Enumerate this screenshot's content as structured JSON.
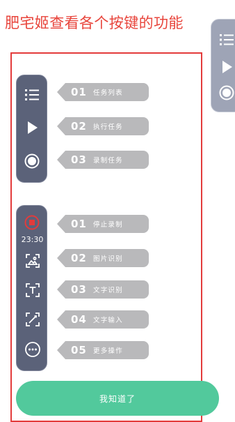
{
  "title": "肥宅姬查看各个按键的功能",
  "floating_bar": {
    "icons": [
      "list-icon",
      "play-icon",
      "record-icon"
    ]
  },
  "top_panel": {
    "icons": [
      "list-icon",
      "play-icon",
      "record-icon"
    ],
    "tags": [
      {
        "num": "01",
        "label": "任务列表"
      },
      {
        "num": "02",
        "label": "执行任务"
      },
      {
        "num": "03",
        "label": "录制任务"
      }
    ]
  },
  "bottom_panel": {
    "timer": "23:30",
    "icons": [
      "stop-record-icon",
      "image-recognition-icon",
      "text-recognition-icon",
      "text-input-icon",
      "more-icon"
    ],
    "tags": [
      {
        "num": "01",
        "label": "停止录制"
      },
      {
        "num": "02",
        "label": "图片识别"
      },
      {
        "num": "03",
        "label": "文字识别"
      },
      {
        "num": "04",
        "label": "文字输入"
      },
      {
        "num": "05",
        "label": "更多操作"
      }
    ]
  },
  "confirm_button": "我知道了",
  "colors": {
    "title": "#e8453c",
    "frame": "#e33b3b",
    "panel": "#5b6279",
    "floating_bar": "#9ea4b6",
    "tag": "#b9b9bb",
    "button": "#52c99c",
    "stop_icon": "#e33b3b"
  }
}
